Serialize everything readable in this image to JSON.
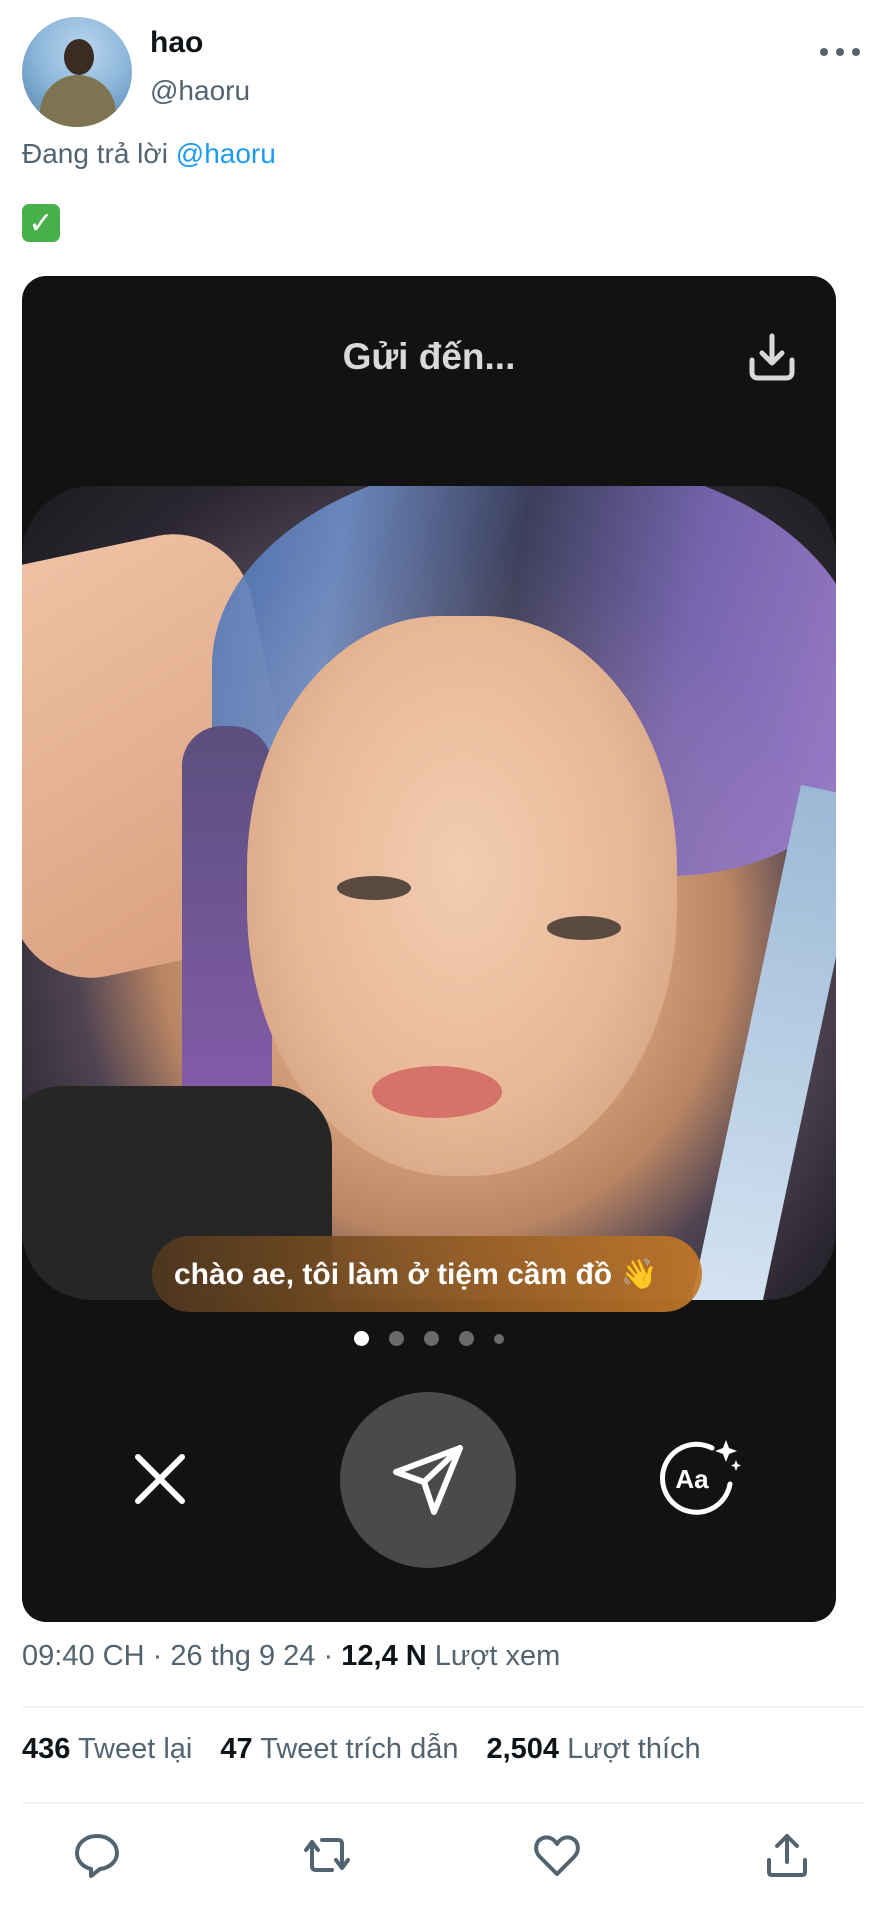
{
  "tweet": {
    "display_name": "hao",
    "handle": "@haoru",
    "reply_prefix": "Đang trả lời",
    "reply_mention": "@haoru",
    "emoji": "✓",
    "emoji_name": "white-check-mark"
  },
  "media": {
    "title": "Gửi đến...",
    "caption": "chào ae, tôi làm ở tiệm cầm đồ 👋",
    "page_indicator": {
      "count": 5,
      "active_index": 0
    },
    "icons": [
      "download-icon",
      "close-icon",
      "send-icon",
      "text-style-icon"
    ]
  },
  "meta": {
    "time": "09:40 CH",
    "date": "26 thg 9 24",
    "views_count": "12,4 N",
    "views_label": "Lượt xem"
  },
  "stats": {
    "retweets_count": "436",
    "retweets_label": "Tweet lại",
    "quotes_count": "47",
    "quotes_label": "Tweet trích dẫn",
    "likes_count": "2,504",
    "likes_label": "Lượt thích"
  },
  "actions": [
    "reply-icon",
    "retweet-icon",
    "like-icon",
    "share-icon"
  ],
  "colors": {
    "link": "#1d9bf0",
    "secondary_text": "#536471",
    "media_bg": "#121212"
  }
}
